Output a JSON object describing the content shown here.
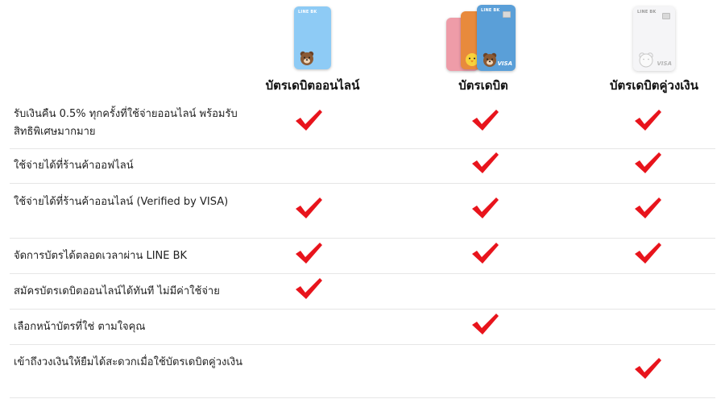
{
  "columns": [
    {
      "title": "บัตรเดบิตออนไลน์",
      "card_brand": "LINE BK",
      "card_color": "#8ecbf5"
    },
    {
      "title": "บัตรเดบิต",
      "card_brand": "LINE BK",
      "card_color": "#5a9fd8",
      "card_visa": "VISA"
    },
    {
      "title": "บัตรเดบิตคู่วงเงิน",
      "card_brand": "LINE BK",
      "card_color": "#f5f5f7",
      "card_visa": "VISA"
    }
  ],
  "rows": [
    {
      "label": "รับเงินคืน 0.5% ทุกครั้งที่ใช้จ่ายออนไลน์ พร้อมรับสิทธิพิเศษมากมาย",
      "checks": [
        true,
        true,
        true
      ]
    },
    {
      "label": "ใช้จ่ายได้ที่ร้านค้าออฟไลน์",
      "checks": [
        false,
        true,
        true
      ]
    },
    {
      "label": "ใช้จ่ายได้ที่ร้านค้าออนไลน์ (Verified by VISA)",
      "checks": [
        true,
        true,
        true
      ]
    },
    {
      "label": "จัดการบัตรได้ตลอดเวลาผ่าน LINE BK",
      "checks": [
        true,
        true,
        true
      ]
    },
    {
      "label": "สมัครบัตรเดบิตออนไลน์ได้ทันที ไม่มีค่าใช้จ่าย",
      "checks": [
        true,
        false,
        false
      ]
    },
    {
      "label": "เลือกหน้าบัตรที่ใช่ ตามใจคุณ",
      "checks": [
        false,
        true,
        false
      ]
    },
    {
      "label": "เข้าถึงวงเงินให้ยืมได้สะดวกเมื่อใช้บัตรเดบิตคู่วงเงิน",
      "checks": [
        false,
        false,
        true
      ]
    }
  ],
  "colors": {
    "check": "#e8141c",
    "divider": "#e6e6e6",
    "text": "#222222"
  },
  "icons": {
    "check": "check-icon",
    "bear": "brown-bear-icon"
  }
}
